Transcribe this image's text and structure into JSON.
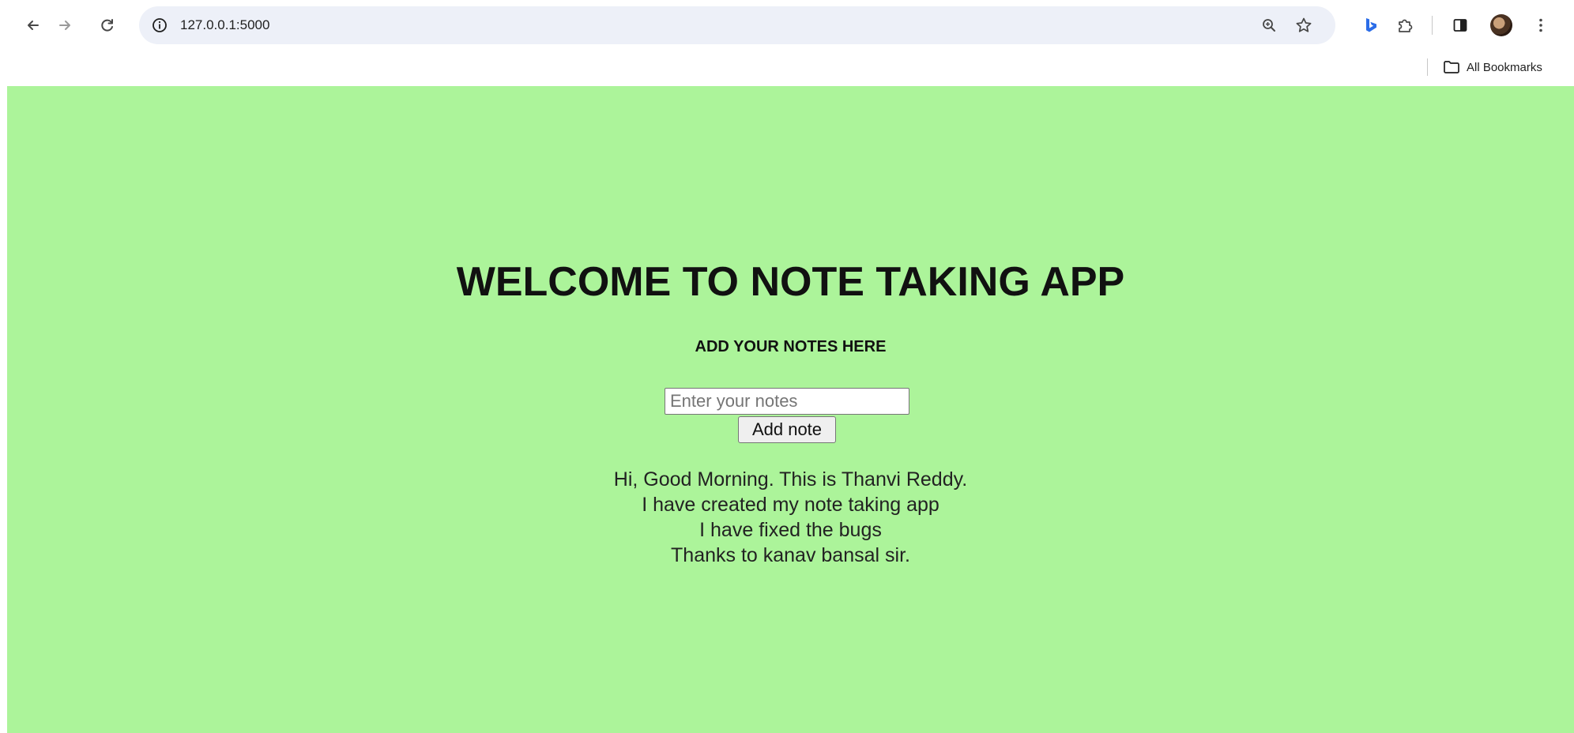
{
  "browser": {
    "url": "127.0.0.1:5000",
    "bookmarks_label": "All Bookmarks",
    "icons": {
      "back": "arrow-left-icon",
      "forward": "arrow-right-icon",
      "reload": "reload-icon",
      "site_info": "info-icon",
      "zoom": "zoom-icon",
      "bookmark": "star-icon",
      "bing": "bing-icon",
      "extensions": "puzzle-icon",
      "side_panel": "side-panel-icon",
      "profile": "avatar",
      "menu": "kebab-menu-icon",
      "folder": "folder-icon"
    }
  },
  "page": {
    "background_color": "#acf49a",
    "heading": "WELCOME TO NOTE TAKING APP",
    "subheading": "ADD YOUR NOTES HERE",
    "input_placeholder": "Enter your notes",
    "input_value": "",
    "add_button_label": "Add note",
    "notes": [
      "Hi, Good Morning. This is Thanvi Reddy.",
      "I have created my note taking app",
      "I have fixed the bugs",
      "Thanks to kanav bansal sir."
    ]
  }
}
